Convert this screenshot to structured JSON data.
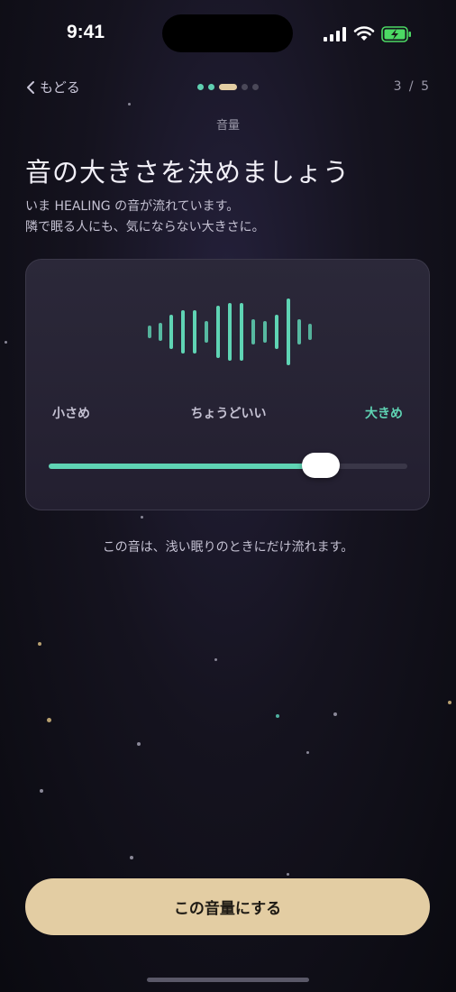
{
  "status_bar": {
    "time": "9:41"
  },
  "nav": {
    "back_label": "もどる",
    "step": "3 / 5",
    "progress": {
      "current": 3,
      "total": 5
    }
  },
  "section_label": "音量",
  "title": "音の大きさを決めましょう",
  "subtitle": [
    "いま HEALING の音が流れています。",
    "隣で眠る人にも、気にならない大きさに。"
  ],
  "volume_card": {
    "labels": {
      "low": "小さめ",
      "mid": "ちょうどいい",
      "high": "大きめ"
    },
    "slider_value": 0.76
  },
  "note": "この音は、浅い眠りのときにだけ流れます。",
  "cta_label": "この音量にする",
  "colors": {
    "accent": "#5fd4b4",
    "button": "#e3cda3",
    "background": "#15131f"
  }
}
